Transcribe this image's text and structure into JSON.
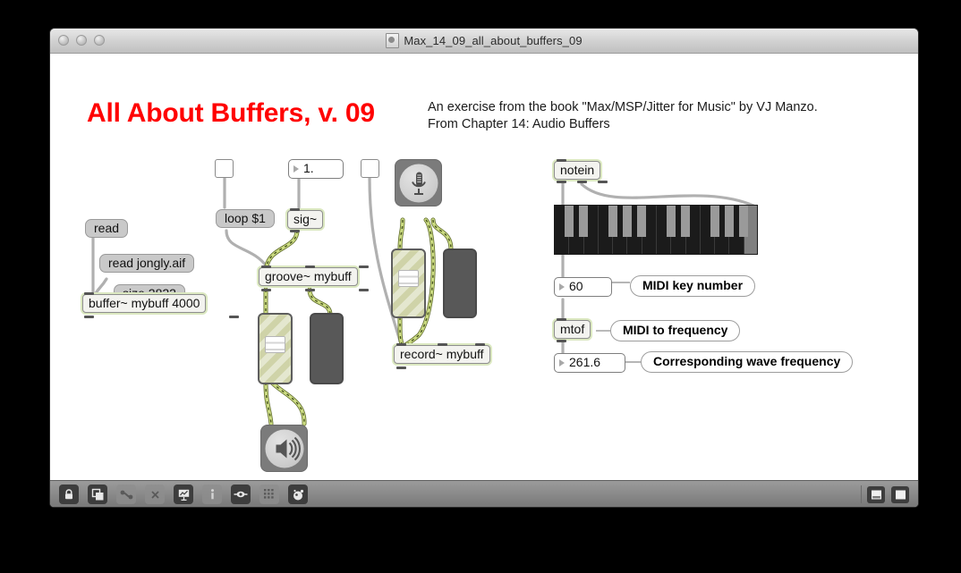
{
  "window": {
    "title": "Max_14_09_all_about_buffers_09",
    "doc_icon": "max-document-icon",
    "lights": [
      "close-button",
      "minimize-button",
      "zoom-button"
    ]
  },
  "patch": {
    "title": "All About Buffers, v. 09",
    "subtitle": "An exercise from the book \"Max/MSP/Jitter for Music\" by VJ Manzo.\nFrom Chapter 14: Audio Buffers",
    "title_color": "#ff0000"
  },
  "objects": {
    "read_msg": "read",
    "read_file_msg": "read jongly.aif",
    "size_msg": "size 2822",
    "buffer_obj": "buffer~ mybuff 4000",
    "loop_msg": "loop $1",
    "sig_obj": "sig~",
    "groove_obj": "groove~ mybuff",
    "record_obj": "record~ mybuff",
    "notein_obj": "notein",
    "mtof_obj": "mtof",
    "number_rate": "1.",
    "number_midi": "60",
    "number_freq": "261.6"
  },
  "comments": {
    "midi_key_number": "MIDI key number",
    "midi_to_frequency": "MIDI to frequency",
    "corresponding_wave_frequency": "Corresponding wave frequency"
  },
  "ui_elements": {
    "toggle_loop": "toggle-loop",
    "toggle_record": "toggle-record",
    "gain_playback": "gain-slider-playback",
    "gain_record": "gain-slider-record",
    "meter_playback": "level-meter-playback",
    "meter_record": "level-meter-record",
    "ezdac": "speaker-icon",
    "ezadc": "microphone-icon",
    "kslider": "piano-keyboard"
  },
  "toolbar": {
    "buttons": [
      {
        "name": "lock-icon",
        "dim": false
      },
      {
        "name": "new-object-icon",
        "dim": false
      },
      {
        "name": "patch-cord-icon",
        "dim": true
      },
      {
        "name": "delete-x-icon",
        "dim": true
      },
      {
        "name": "presentation-icon",
        "dim": false
      },
      {
        "name": "info-icon",
        "dim": true
      },
      {
        "name": "inspector-icon",
        "dim": false
      },
      {
        "name": "grid-icon",
        "dim": true
      },
      {
        "name": "debug-icon",
        "dim": false
      }
    ],
    "view_buttons": [
      "split-view-icon",
      "full-view-icon"
    ]
  },
  "colors": {
    "title_red": "#ff0000",
    "signal_cable": "#b8c96a",
    "control_cable": "#b0b0b0",
    "object_halo": "#dbe8c0",
    "message_fill": "#c9c9c9"
  }
}
